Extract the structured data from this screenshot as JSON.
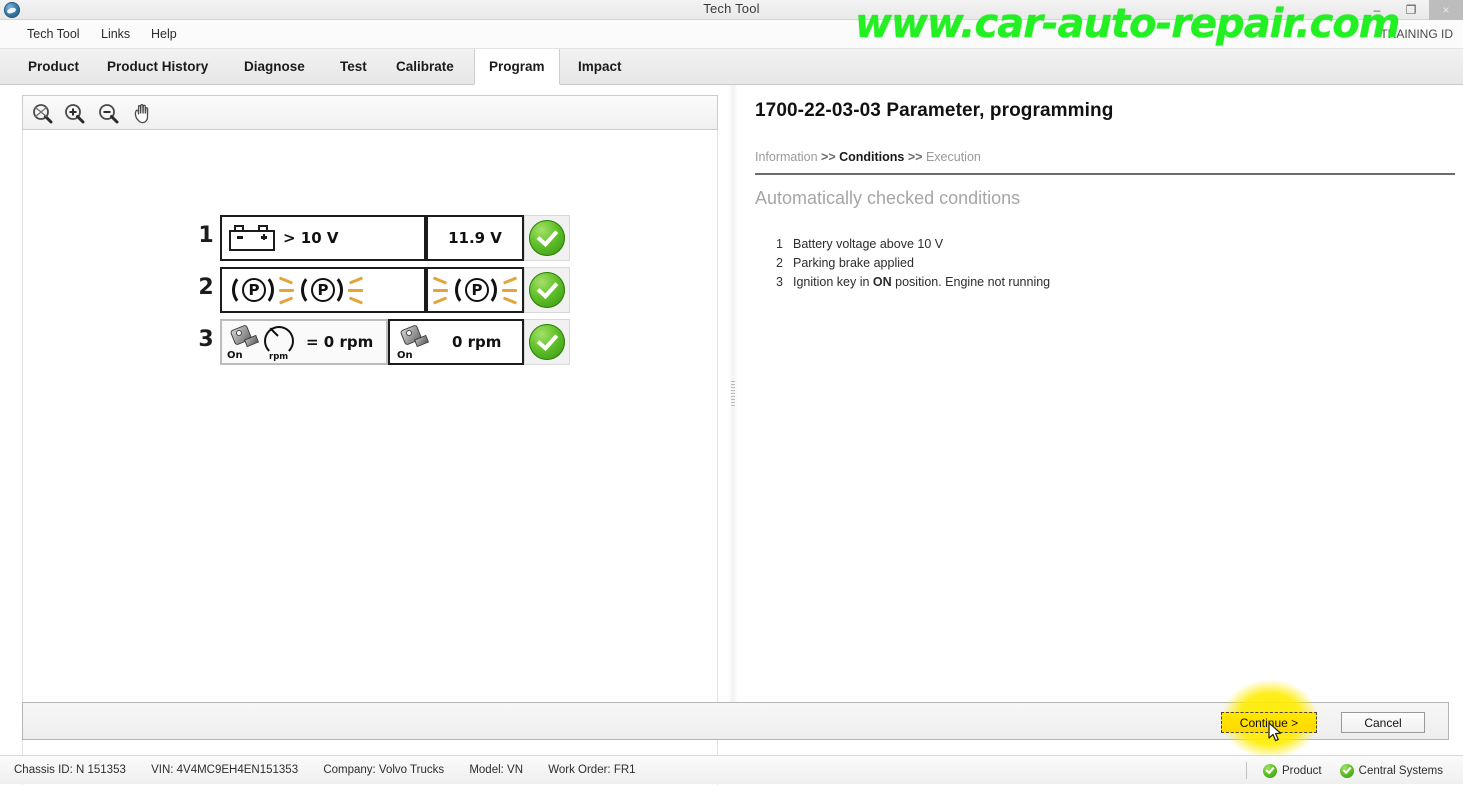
{
  "window": {
    "title": "Tech Tool",
    "app_icon": "volvo-tech-tool-icon",
    "minimize": "–",
    "maximize": "❐",
    "close": "×"
  },
  "watermark": {
    "text": "www.car-auto-repair.com",
    "color": "#23f023"
  },
  "menubar": {
    "items": [
      {
        "label": "Tech Tool"
      },
      {
        "label": "Links"
      },
      {
        "label": "Help"
      }
    ],
    "training_id": "TRAINING ID"
  },
  "tabs": [
    {
      "label": "Product",
      "active": false
    },
    {
      "label": "Product History",
      "active": false
    },
    {
      "label": "Diagnose",
      "active": false
    },
    {
      "label": "Test",
      "active": false
    },
    {
      "label": "Calibrate",
      "active": false
    },
    {
      "label": "Program",
      "active": true
    },
    {
      "label": "Impact",
      "active": false
    }
  ],
  "viewer": {
    "toolbar": [
      {
        "name": "fit-to-window-icon",
        "label": "Fit to window"
      },
      {
        "name": "zoom-in-icon",
        "label": "Zoom in"
      },
      {
        "name": "zoom-out-icon",
        "label": "Zoom out"
      },
      {
        "name": "pan-hand-icon",
        "label": "Pan"
      }
    ],
    "conditions": [
      {
        "number": "1",
        "icon": "battery-icon",
        "requirement": "> 10 V",
        "value": "11.9 V",
        "status": "ok"
      },
      {
        "number": "2",
        "icon": "parking-brake-icon",
        "requirement": "(P)",
        "value": "(P)",
        "status": "ok"
      },
      {
        "number": "3",
        "icon": "ignition-key-icon",
        "key_state": "On",
        "gauge_unit": "rpm",
        "requirement": "= 0 rpm",
        "value": "0 rpm",
        "value_key_state": "On",
        "status": "ok"
      }
    ]
  },
  "task": {
    "title": "1700-22-03-03 Parameter, programming",
    "breadcrumb": {
      "step1": "Information",
      "sep": ">>",
      "step2": "Conditions",
      "step3": "Execution"
    },
    "section_heading": "Automatically checked conditions",
    "conditions": [
      {
        "num": "1",
        "pre": "Battery voltage above 10 V",
        "bold": "",
        "post": ""
      },
      {
        "num": "2",
        "pre": "Parking brake applied",
        "bold": "",
        "post": ""
      },
      {
        "num": "3",
        "pre": "Ignition key in ",
        "bold": "ON",
        "post": " position. Engine not running"
      }
    ]
  },
  "buttons": {
    "continue": "Continue >",
    "cancel": "Cancel"
  },
  "statusbar": {
    "chassis_id": "Chassis ID: N 151353",
    "vin": "VIN: 4V4MC9EH4EN151353",
    "company": "Company: Volvo Trucks",
    "model": "Model: VN",
    "work_order": "Work Order: FR1",
    "indicators": [
      {
        "label": "Product",
        "status": "ok"
      },
      {
        "label": "Central Systems",
        "status": "ok"
      }
    ]
  }
}
